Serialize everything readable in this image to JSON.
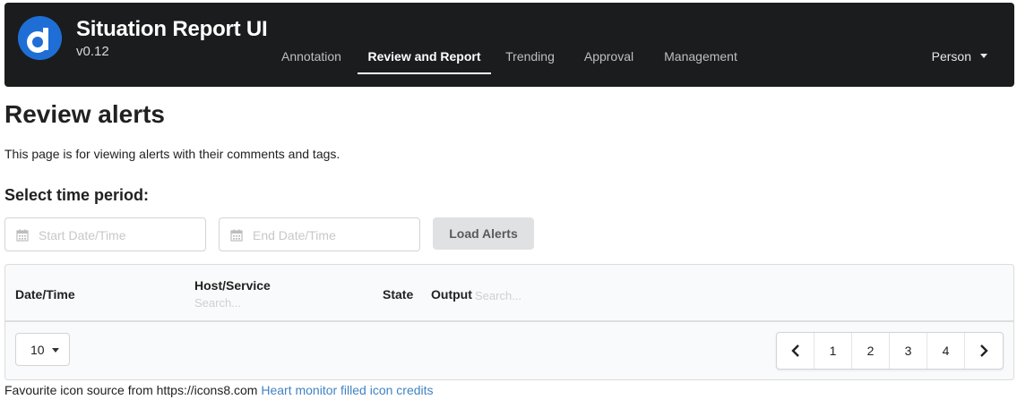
{
  "header": {
    "title": "Situation Report UI",
    "version": "v0.12",
    "logo_icon": "d-logo-icon",
    "nav": [
      {
        "label": "Annotation",
        "active": false
      },
      {
        "label": "Review and Report",
        "active": true
      },
      {
        "label": "Trending",
        "active": false
      },
      {
        "label": "Approval",
        "active": false
      },
      {
        "label": "Management",
        "active": false
      }
    ],
    "user_menu": "Person"
  },
  "main": {
    "title": "Review alerts",
    "description": "This page is for viewing alerts with their comments and tags.",
    "time_period_label": "Select time period:",
    "start_placeholder": "Start Date/Time",
    "end_placeholder": "End Date/Time",
    "load_button": "Load Alerts"
  },
  "table": {
    "columns": {
      "datetime": "Date/Time",
      "host_service": "Host/Service",
      "state": "State",
      "output": "Output"
    },
    "search_placeholder": "Search...",
    "page_size": "10",
    "pages": [
      "1",
      "2",
      "3",
      "4"
    ]
  },
  "footer": {
    "text": "Favourite icon source from https://icons8.com",
    "link_text": "Heart monitor filled icon credits"
  },
  "colors": {
    "header_bg": "#1b1c1d",
    "logo_bg": "#1e6ed6",
    "link": "#4183c4"
  }
}
